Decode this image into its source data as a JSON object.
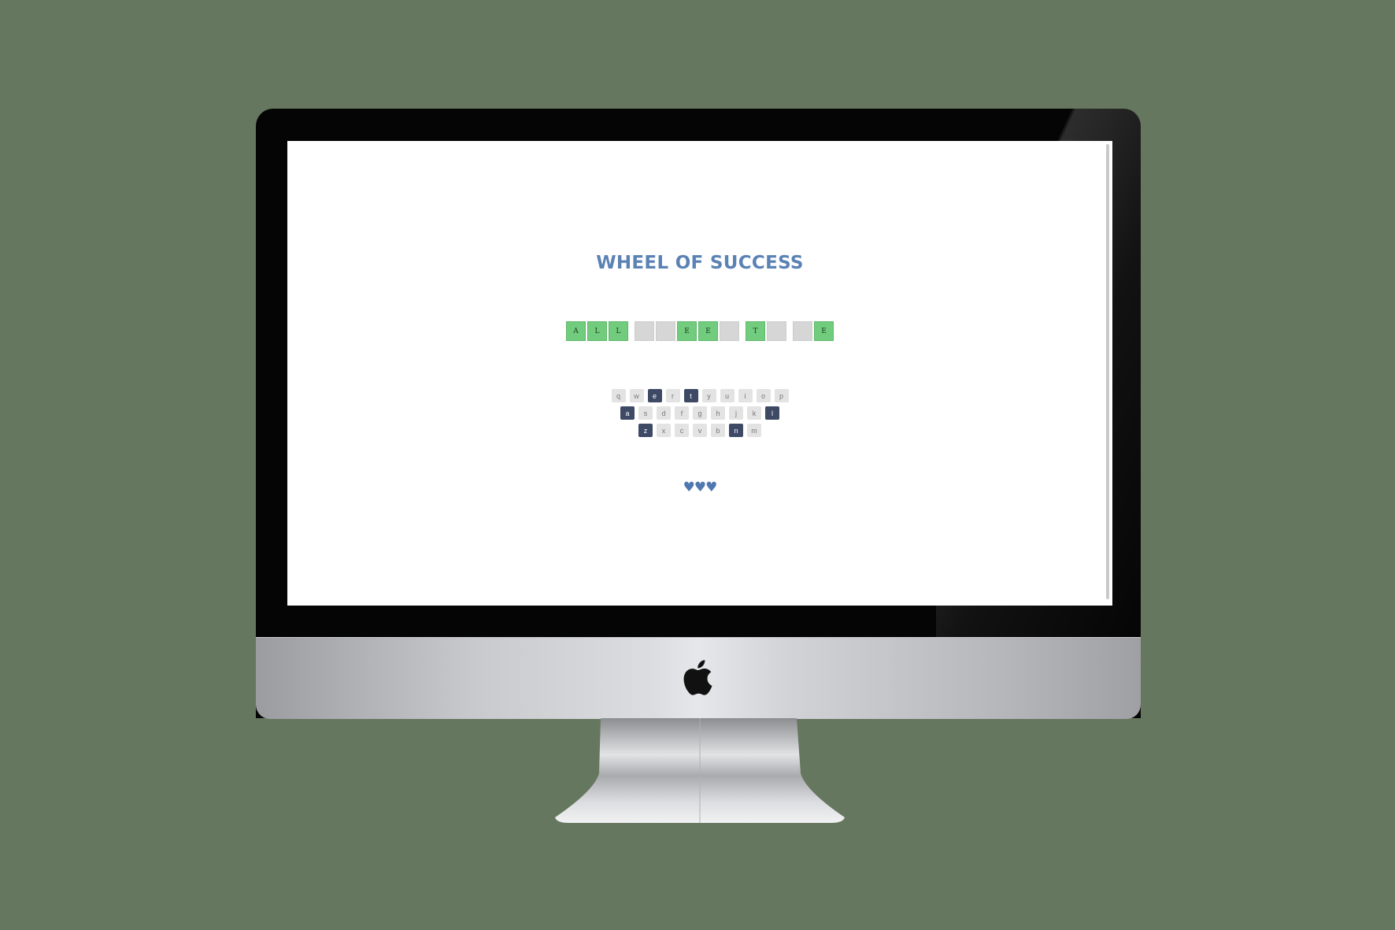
{
  "game": {
    "title": "WHEEL OF SUCCESS",
    "puzzle": [
      [
        {
          "letter": "A",
          "revealed": true
        },
        {
          "letter": "L",
          "revealed": true
        },
        {
          "letter": "L",
          "revealed": true
        }
      ],
      [
        {
          "letter": "",
          "revealed": false
        },
        {
          "letter": "",
          "revealed": false
        },
        {
          "letter": "E",
          "revealed": true
        },
        {
          "letter": "E",
          "revealed": true
        },
        {
          "letter": "",
          "revealed": false
        }
      ],
      [
        {
          "letter": "T",
          "revealed": true
        },
        {
          "letter": "",
          "revealed": false
        }
      ],
      [
        {
          "letter": "",
          "revealed": false
        },
        {
          "letter": "E",
          "revealed": true
        }
      ]
    ],
    "keyboard": [
      [
        {
          "key": "q",
          "used": false
        },
        {
          "key": "w",
          "used": false
        },
        {
          "key": "e",
          "used": true
        },
        {
          "key": "r",
          "used": false
        },
        {
          "key": "t",
          "used": true
        },
        {
          "key": "y",
          "used": false
        },
        {
          "key": "u",
          "used": false
        },
        {
          "key": "i",
          "used": false
        },
        {
          "key": "o",
          "used": false
        },
        {
          "key": "p",
          "used": false
        }
      ],
      [
        {
          "key": "a",
          "used": true
        },
        {
          "key": "s",
          "used": false
        },
        {
          "key": "d",
          "used": false
        },
        {
          "key": "f",
          "used": false
        },
        {
          "key": "g",
          "used": false
        },
        {
          "key": "h",
          "used": false
        },
        {
          "key": "j",
          "used": false
        },
        {
          "key": "k",
          "used": false
        },
        {
          "key": "l",
          "used": true
        }
      ],
      [
        {
          "key": "z",
          "used": true
        },
        {
          "key": "x",
          "used": false
        },
        {
          "key": "c",
          "used": false
        },
        {
          "key": "v",
          "used": false
        },
        {
          "key": "b",
          "used": false
        },
        {
          "key": "n",
          "used": true
        },
        {
          "key": "m",
          "used": false
        }
      ]
    ],
    "lives": "♥♥♥"
  },
  "colors": {
    "background": "#66775f",
    "title": "#5b82b4",
    "tile_revealed": "#72cc7e",
    "tile_hidden": "#d6d6d6",
    "key_used": "#3d4965",
    "key_unused": "#e3e3e3",
    "hearts": "#4f78b0"
  },
  "icons": {
    "logo": "apple-logo-icon",
    "lives": "heart-icon"
  }
}
